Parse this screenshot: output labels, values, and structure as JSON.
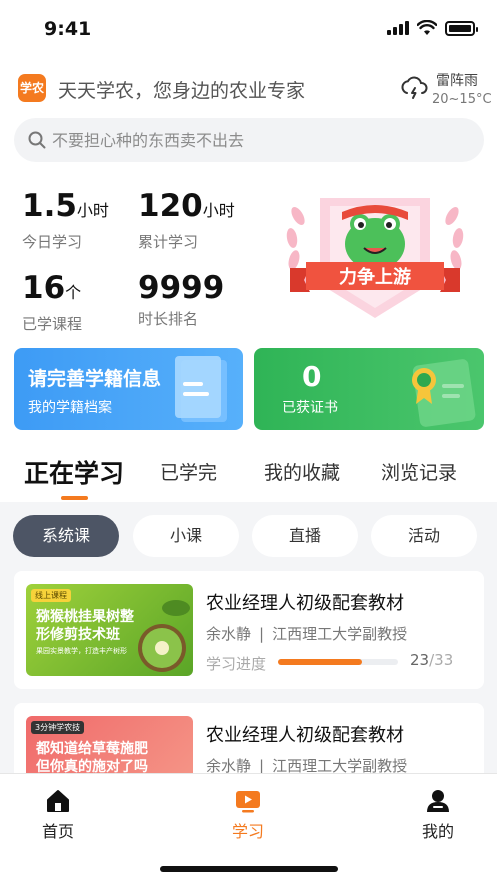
{
  "status": {
    "time": "9:41"
  },
  "header": {
    "logo_text": "学农",
    "slogan": "天天学农，您身边的农业专家",
    "weather": {
      "condition": "雷阵雨",
      "temp": "20~15°C",
      "icon": "thunderstorm-icon"
    }
  },
  "search": {
    "placeholder": "不要担心种的东西卖不出去"
  },
  "stats": [
    {
      "value": "1.5",
      "unit": "小时",
      "label": "今日学习"
    },
    {
      "value": "120",
      "unit": "小时",
      "label": "累计学习"
    },
    {
      "value": "16",
      "unit": "个",
      "label": "已学课程"
    },
    {
      "value": "9999",
      "unit": "",
      "label": "时长排名"
    }
  ],
  "badge": {
    "text": "力争上游",
    "icon": "frog-mascot-badge"
  },
  "cards": {
    "profile": {
      "title": "请完善学籍信息",
      "sub": "我的学籍档案"
    },
    "certificate": {
      "count": "0",
      "sub": "已获证书"
    }
  },
  "tabs": [
    "正在学习",
    "已学完",
    "我的收藏",
    "浏览记录"
  ],
  "chips": [
    "系统课",
    "小课",
    "直播",
    "活动"
  ],
  "courses": [
    {
      "thumb_tag": "线上课程",
      "thumb_title": "猕猴桃挂果树整形修剪技术班",
      "thumb_sub": "果园实景教学，打造丰产树形",
      "title": "农业经理人初级配套教材",
      "author": "余水静",
      "org": "江西理工大学副教授",
      "progress_label": "学习进度",
      "progress_done": "23",
      "progress_total": "/33",
      "progress_fraction": 0.697
    },
    {
      "thumb_tag": "3分钟学农技",
      "thumb_title": "都知道给草莓施肥但你真的施对了吗",
      "title": "农业经理人初级配套教材",
      "author": "余水静",
      "org": "江西理工大学副教授"
    }
  ],
  "nav": [
    {
      "label": "首页",
      "icon": "home-icon"
    },
    {
      "label": "学习",
      "icon": "tv-play-icon"
    },
    {
      "label": "我的",
      "icon": "user-icon"
    }
  ],
  "colors": {
    "accent": "#f47a1f",
    "blue": "#3d9bf5",
    "green": "#2fb456",
    "chip_active": "#4d5565"
  }
}
